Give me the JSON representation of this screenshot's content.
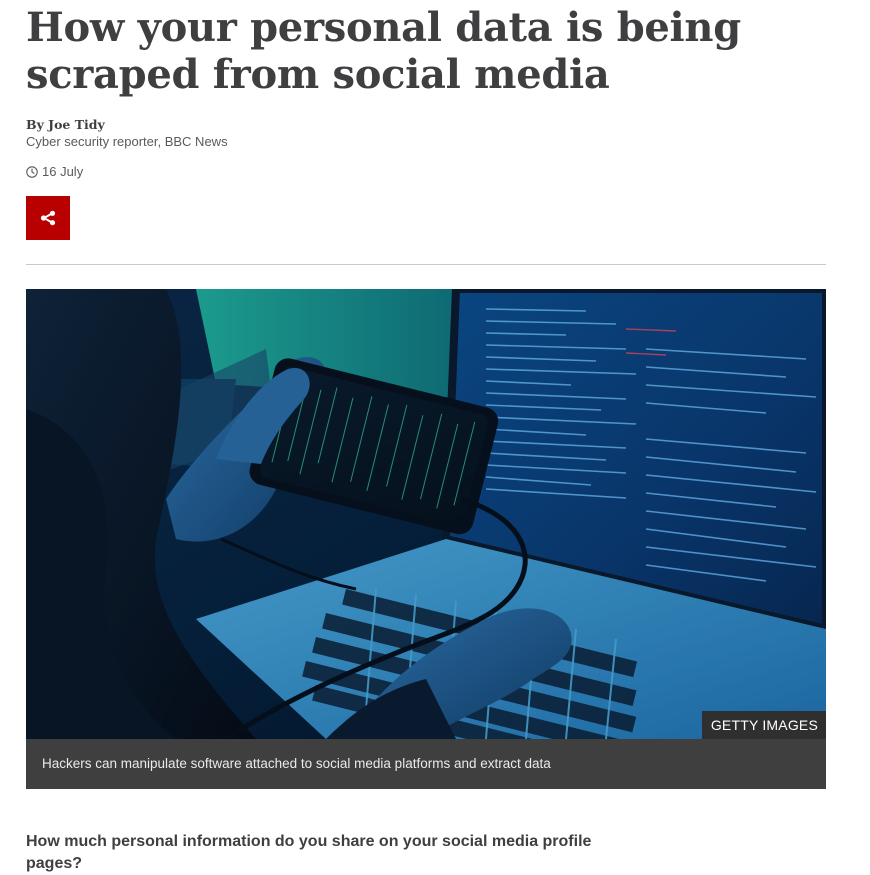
{
  "article": {
    "headline": "How your personal data is being scraped from social media",
    "byline": {
      "name": "By Joe Tidy",
      "role": "Cyber security reporter, BBC News"
    },
    "date": "16 July",
    "share_icon": "share-icon",
    "clock_icon": "clock-icon",
    "accent_color": "#b80000"
  },
  "figure": {
    "credit": "GETTY IMAGES",
    "caption": "Hackers can manipulate software attached to social media platforms and extract data"
  },
  "body": {
    "lead": "How much personal information do you share on your social media profile pages?"
  }
}
